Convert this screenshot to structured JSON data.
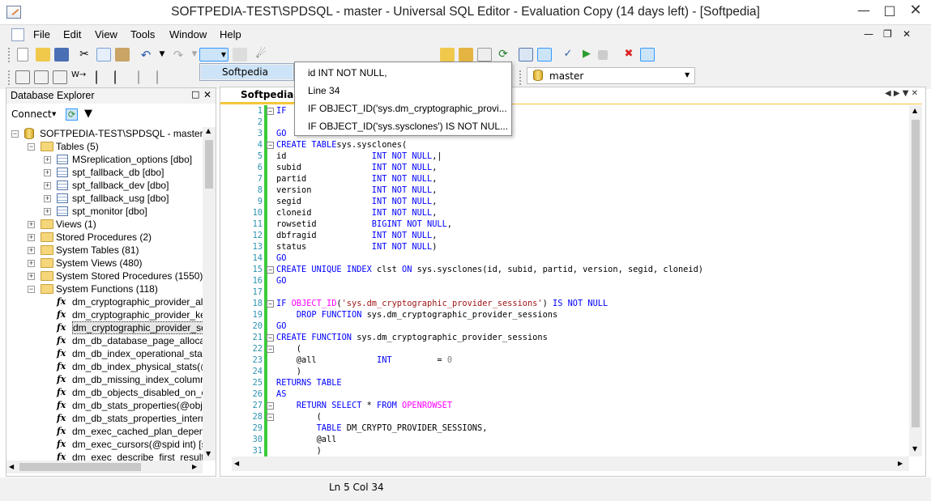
{
  "window": {
    "title": "SOFTPEDIA-TEST\\SPDSQL - master - Universal SQL Editor - Evaluation Copy (14 days left) - [Softpedia]"
  },
  "menu": [
    "File",
    "Edit",
    "View",
    "Tools",
    "Window",
    "Help"
  ],
  "left_panel": {
    "title": "Database Explorer",
    "connect_label": "Connect",
    "tree": [
      {
        "label": "SOFTPEDIA-TEST\\SPDSQL - master",
        "level": 0,
        "icon": "database-icon",
        "toggle": "-"
      },
      {
        "label": "Tables (5)",
        "level": 1,
        "icon": "folder-icon",
        "toggle": "-"
      },
      {
        "label": "MSreplication_options [dbo]",
        "level": 2,
        "icon": "table-icon",
        "toggle": "+"
      },
      {
        "label": "spt_fallback_db [dbo]",
        "level": 2,
        "icon": "table-icon",
        "toggle": "+"
      },
      {
        "label": "spt_fallback_dev [dbo]",
        "level": 2,
        "icon": "table-icon",
        "toggle": "+"
      },
      {
        "label": "spt_fallback_usg [dbo]",
        "level": 2,
        "icon": "table-icon",
        "toggle": "+"
      },
      {
        "label": "spt_monitor [dbo]",
        "level": 2,
        "icon": "table-icon",
        "toggle": "+"
      },
      {
        "label": "Views (1)",
        "level": 1,
        "icon": "folder-icon",
        "toggle": "+"
      },
      {
        "label": "Stored Procedures (2)",
        "level": 1,
        "icon": "folder-icon",
        "toggle": "+"
      },
      {
        "label": "System Tables (81)",
        "level": 1,
        "icon": "folder-icon",
        "toggle": "+"
      },
      {
        "label": "System Views (480)",
        "level": 1,
        "icon": "folder-icon",
        "toggle": "+"
      },
      {
        "label": "System Stored Procedures (1550)",
        "level": 1,
        "icon": "folder-icon",
        "toggle": "+"
      },
      {
        "label": "System Functions (118)",
        "level": 1,
        "icon": "folder-icon",
        "toggle": "-"
      },
      {
        "label": "dm_cryptographic_provider_al",
        "level": 2,
        "icon": "function-icon",
        "toggle": ""
      },
      {
        "label": "dm_cryptographic_provider_ke",
        "level": 2,
        "icon": "function-icon",
        "toggle": ""
      },
      {
        "label": "dm_cryptographic_provider_se",
        "level": 2,
        "icon": "function-icon",
        "toggle": "",
        "selected": true
      },
      {
        "label": "dm_db_database_page_allocat",
        "level": 2,
        "icon": "function-icon",
        "toggle": ""
      },
      {
        "label": "dm_db_index_operational_stat",
        "level": 2,
        "icon": "function-icon",
        "toggle": ""
      },
      {
        "label": "dm_db_index_physical_stats(@",
        "level": 2,
        "icon": "function-icon",
        "toggle": ""
      },
      {
        "label": "dm_db_missing_index_columr",
        "level": 2,
        "icon": "function-icon",
        "toggle": ""
      },
      {
        "label": "dm_db_objects_disabled_on_c",
        "level": 2,
        "icon": "function-icon",
        "toggle": ""
      },
      {
        "label": "dm_db_stats_properties(@obje",
        "level": 2,
        "icon": "function-icon",
        "toggle": ""
      },
      {
        "label": "dm_db_stats_properties_intern",
        "level": 2,
        "icon": "function-icon",
        "toggle": ""
      },
      {
        "label": "dm_exec_cached_plan_depenc",
        "level": 2,
        "icon": "function-icon",
        "toggle": ""
      },
      {
        "label": "dm_exec_cursors(@spid int) [s",
        "level": 2,
        "icon": "function-icon",
        "toggle": ""
      },
      {
        "label": "dm_exec_describe_first_result",
        "level": 2,
        "icon": "function-icon",
        "toggle": ""
      }
    ]
  },
  "editor": {
    "tab_label": "Softpedia",
    "lines": [
      {
        "n": "1",
        "fold": "-",
        "parts": [
          [
            "kw",
            "IF"
          ]
        ]
      },
      {
        "n": "2",
        "fold": "",
        "parts": []
      },
      {
        "n": "3",
        "fold": "",
        "parts": [
          [
            "kw",
            "GO"
          ]
        ]
      },
      {
        "n": "4",
        "fold": "-",
        "parts": [
          [
            "kw",
            "CREATE TABLE"
          ],
          [
            "",
            "sys.sysclones("
          ]
        ]
      },
      {
        "n": "5",
        "fold": "",
        "parts": [
          [
            "",
            "id                 "
          ],
          [
            "kw",
            "INT NOT NULL"
          ],
          [
            "",
            ",|"
          ]
        ]
      },
      {
        "n": "6",
        "fold": "",
        "parts": [
          [
            "",
            "subid              "
          ],
          [
            "kw",
            "INT NOT NULL"
          ],
          [
            "",
            ","
          ]
        ]
      },
      {
        "n": "7",
        "fold": "",
        "parts": [
          [
            "",
            "partid             "
          ],
          [
            "kw",
            "INT NOT NULL"
          ],
          [
            "",
            ","
          ]
        ]
      },
      {
        "n": "8",
        "fold": "",
        "parts": [
          [
            "",
            "version            "
          ],
          [
            "kw",
            "INT NOT NULL"
          ],
          [
            "",
            ","
          ]
        ]
      },
      {
        "n": "9",
        "fold": "",
        "parts": [
          [
            "",
            "segid              "
          ],
          [
            "kw",
            "INT NOT NULL"
          ],
          [
            "",
            ","
          ]
        ]
      },
      {
        "n": "10",
        "fold": "",
        "parts": [
          [
            "",
            "cloneid            "
          ],
          [
            "kw",
            "INT NOT NULL"
          ],
          [
            "",
            ","
          ]
        ]
      },
      {
        "n": "11",
        "fold": "",
        "parts": [
          [
            "",
            "rowsetid           "
          ],
          [
            "kw",
            "BIGINT NOT NULL"
          ],
          [
            "",
            ","
          ]
        ]
      },
      {
        "n": "12",
        "fold": "",
        "parts": [
          [
            "",
            "dbfragid           "
          ],
          [
            "kw",
            "INT NOT NULL"
          ],
          [
            "",
            ","
          ]
        ]
      },
      {
        "n": "13",
        "fold": "",
        "parts": [
          [
            "",
            "status             "
          ],
          [
            "kw",
            "INT NOT NULL"
          ],
          [
            "",
            ")"
          ]
        ]
      },
      {
        "n": "14",
        "fold": "",
        "parts": [
          [
            "kw",
            "GO"
          ]
        ]
      },
      {
        "n": "15",
        "fold": "-",
        "parts": [
          [
            "kw",
            "CREATE UNIQUE INDEX"
          ],
          [
            "",
            " clst "
          ],
          [
            "kw",
            "ON"
          ],
          [
            "",
            " sys.sysclones(id, subid, partid, version, segid, cloneid)"
          ]
        ]
      },
      {
        "n": "16",
        "fold": "",
        "parts": [
          [
            "kw",
            "GO"
          ]
        ]
      },
      {
        "n": "17",
        "fold": "",
        "parts": []
      },
      {
        "n": "18",
        "fold": "-",
        "parts": [
          [
            "kw",
            "IF"
          ],
          [
            "fn",
            " OBJECT_ID"
          ],
          [
            "",
            "("
          ],
          [
            "str",
            "'sys.dm_cryptographic_provider_sessions'"
          ],
          [
            "",
            ") "
          ],
          [
            "kw",
            "IS NOT NULL"
          ]
        ]
      },
      {
        "n": "19",
        "fold": "",
        "parts": [
          [
            "",
            "    "
          ],
          [
            "kw",
            "DROP FUNCTION"
          ],
          [
            "",
            " sys.dm_cryptographic_provider_sessions"
          ]
        ]
      },
      {
        "n": "20",
        "fold": "",
        "parts": [
          [
            "kw",
            "GO"
          ]
        ]
      },
      {
        "n": "21",
        "fold": "-",
        "parts": [
          [
            "kw",
            "CREATE FUNCTION"
          ],
          [
            "",
            " sys.dm_cryptographic_provider_sessions"
          ]
        ]
      },
      {
        "n": "22",
        "fold": "-",
        "parts": [
          [
            "",
            "    ("
          ]
        ]
      },
      {
        "n": "23",
        "fold": "",
        "parts": [
          [
            "",
            "    @all            "
          ],
          [
            "kw",
            "INT"
          ],
          [
            "",
            "         = "
          ],
          [
            "num",
            "0"
          ]
        ]
      },
      {
        "n": "24",
        "fold": "",
        "parts": [
          [
            "",
            "    )"
          ]
        ]
      },
      {
        "n": "25",
        "fold": "",
        "parts": [
          [
            "kw",
            "RETURNS TABLE"
          ]
        ]
      },
      {
        "n": "26",
        "fold": "",
        "parts": [
          [
            "kw",
            "AS"
          ]
        ]
      },
      {
        "n": "27",
        "fold": "-",
        "parts": [
          [
            "",
            "    "
          ],
          [
            "kw",
            "RETURN SELECT"
          ],
          [
            "",
            " * "
          ],
          [
            "kw",
            "FROM"
          ],
          [
            "fn",
            " OPENROWSET"
          ]
        ]
      },
      {
        "n": "28",
        "fold": "-",
        "parts": [
          [
            "",
            "        ("
          ]
        ]
      },
      {
        "n": "29",
        "fold": "",
        "parts": [
          [
            "",
            "        "
          ],
          [
            "kw",
            "TABLE"
          ],
          [
            "",
            " DM_CRYPTO_PROVIDER_SESSIONS,"
          ]
        ]
      },
      {
        "n": "30",
        "fold": "",
        "parts": [
          [
            "",
            "        @all"
          ]
        ]
      },
      {
        "n": "31",
        "fold": "",
        "parts": [
          [
            "",
            "        )"
          ]
        ]
      }
    ]
  },
  "popup": {
    "items": [
      "id              INT NOT NULL,",
      "Line 34",
      "IF OBJECT_ID('sys.dm_cryptographic_provi...",
      "IF OBJECT_ID('sys.sysclones') IS NOT NUL..."
    ]
  },
  "dropdown_menu": {
    "item": "Softpedia"
  },
  "toolbar": {
    "connection": "master"
  },
  "status": {
    "position": "Ln 5  Col 34"
  },
  "colors": {
    "accent": "#3399ff",
    "keyword": "#0000ff",
    "function": "#ff00ff",
    "string": "#a31515",
    "gutter": "#3ccc3c"
  }
}
